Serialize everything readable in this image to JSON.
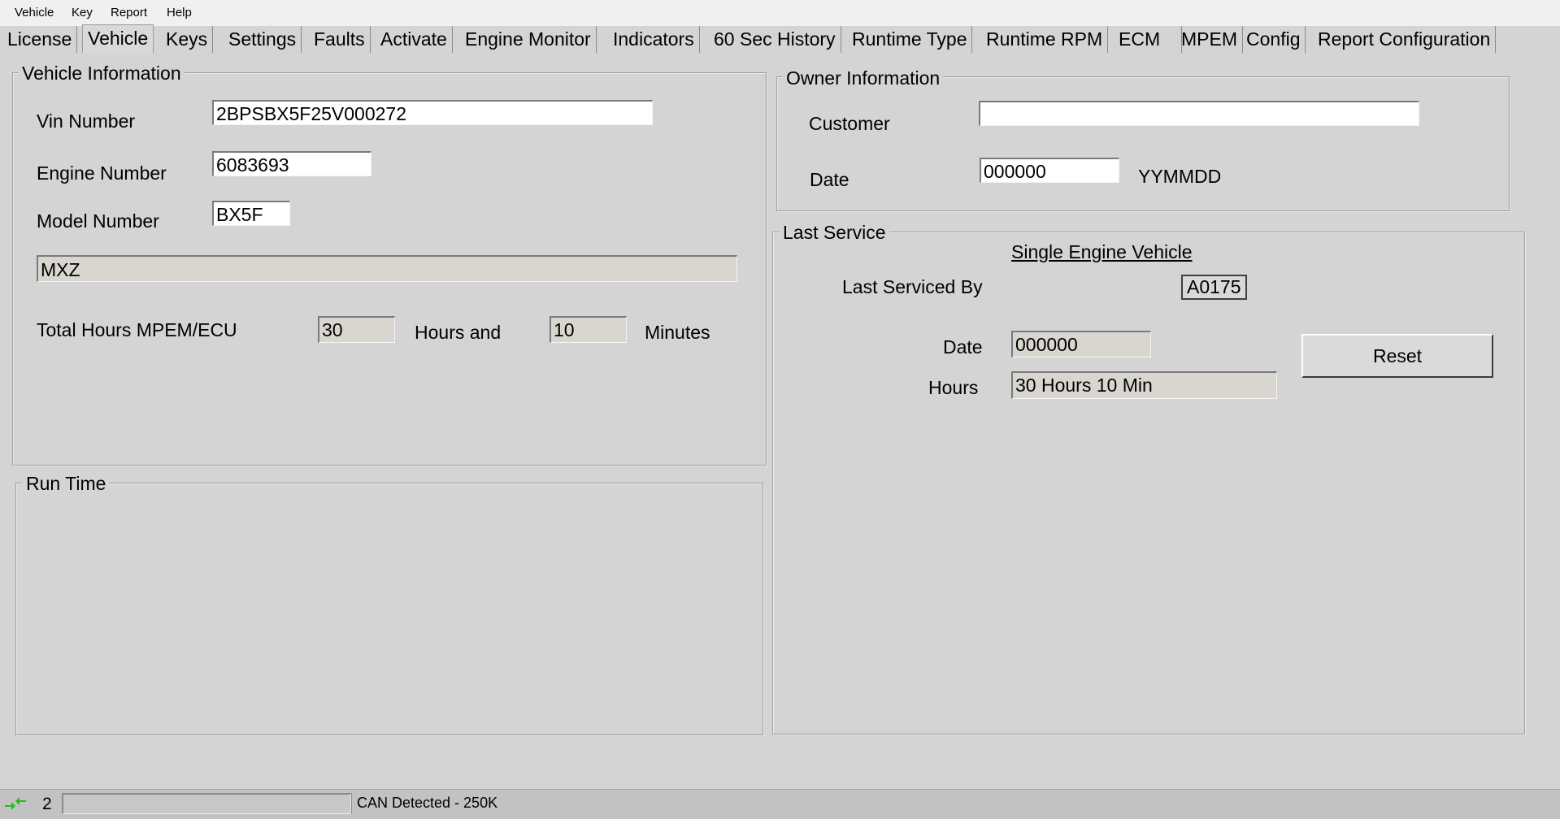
{
  "menu": {
    "items": [
      "Vehicle",
      "Key",
      "Report",
      "Help"
    ]
  },
  "tabs": [
    "License",
    "Vehicle",
    "Keys",
    "Settings",
    "Faults",
    "Activate",
    "Engine Monitor",
    "Indicators",
    "60 Sec History",
    "Runtime Type",
    "Runtime RPM",
    "ECM",
    "MPEM",
    "Config",
    "Report Configuration"
  ],
  "active_tab": "Vehicle",
  "vehicle_info": {
    "title": "Vehicle Information",
    "vin_label": "Vin Number",
    "vin_value": "2BPSBX5F25V000272",
    "engine_label": "Engine Number",
    "engine_value": "6083693",
    "model_label": "Model Number",
    "model_value": "BX5F",
    "model_name": "MXZ",
    "total_hours_label": "Total Hours MPEM/ECU",
    "hours_value": "30",
    "hours_and_label": "Hours and",
    "minutes_value": "10",
    "minutes_label": "Minutes"
  },
  "run_time": {
    "title": "Run Time"
  },
  "owner_info": {
    "title": "Owner Information",
    "customer_label": "Customer",
    "customer_value": "",
    "date_label": "Date",
    "date_value": "000000",
    "date_format": "YYMMDD"
  },
  "last_service": {
    "title": "Last Service",
    "vehicle_type": "Single Engine Vehicle",
    "serviced_by_label": "Last Serviced By",
    "serviced_by_value": "A0175",
    "date_label": "Date",
    "date_value": "000000",
    "hours_label": "Hours",
    "hours_value": "30 Hours  10 Min",
    "reset_label": "Reset"
  },
  "status_bar": {
    "connection_icon": "connection-arrows-icon",
    "number": "2",
    "message": "CAN Detected - 250K"
  }
}
